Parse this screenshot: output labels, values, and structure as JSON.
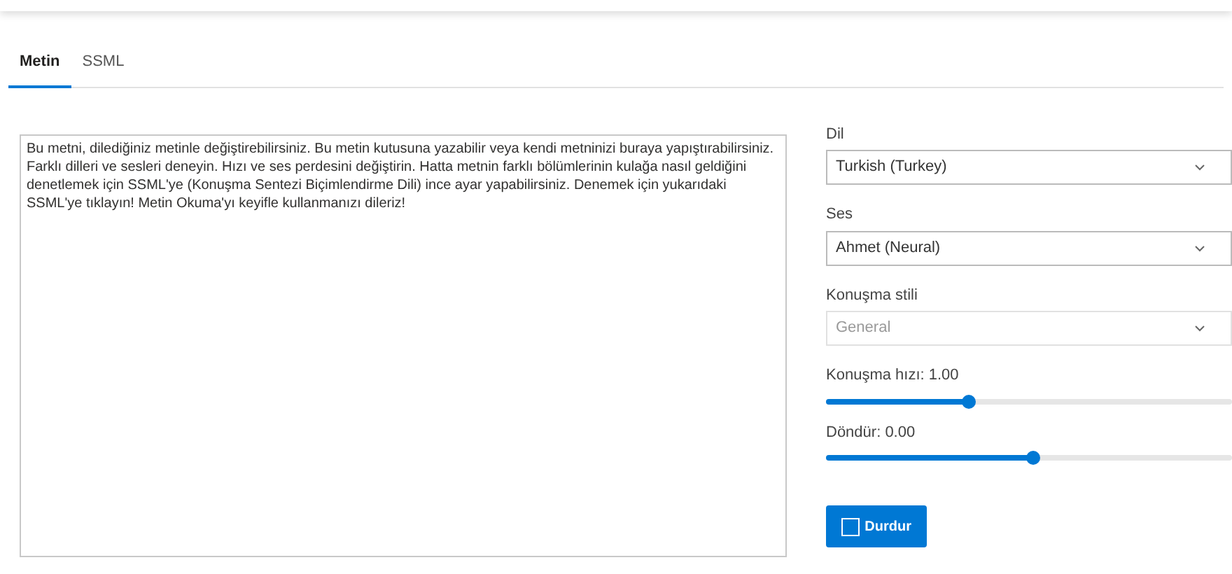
{
  "tabs": [
    {
      "label": "Metin",
      "selected": true
    },
    {
      "label": "SSML",
      "selected": false
    }
  ],
  "editor": {
    "value": "Bu metni, dilediğiniz metinle değiştirebilirsiniz. Bu metin kutusuna yazabilir veya kendi metninizi buraya yapıştırabilirsiniz. Farklı dilleri ve sesleri deneyin. Hızı ve ses perdesini değiştirin. Hatta metnin farklı bölümlerinin kulağa nasıl geldiğini denetlemek için SSML'ye (Konuşma Sentezi Biçimlendirme Dili) ince ayar yapabilirsiniz. Denemek için yukarıdaki SSML'ye tıklayın! Metin Okuma'yı keyifle kullanmanızı dileriz!"
  },
  "selects": [
    {
      "label": "Dil",
      "value": "Turkish (Turkey)",
      "disabled": false
    },
    {
      "label": "Ses",
      "value": "Ahmet (Neural)",
      "disabled": false
    },
    {
      "label": "Konuşma stili",
      "value": "General",
      "disabled": true
    }
  ],
  "sliders": [
    {
      "label": "Konuşma hızı: 1.00",
      "level": 0.35
    },
    {
      "label": "Döndür: 0.00",
      "level": 0.51
    }
  ],
  "stop_button": {
    "label": "Durdur"
  }
}
